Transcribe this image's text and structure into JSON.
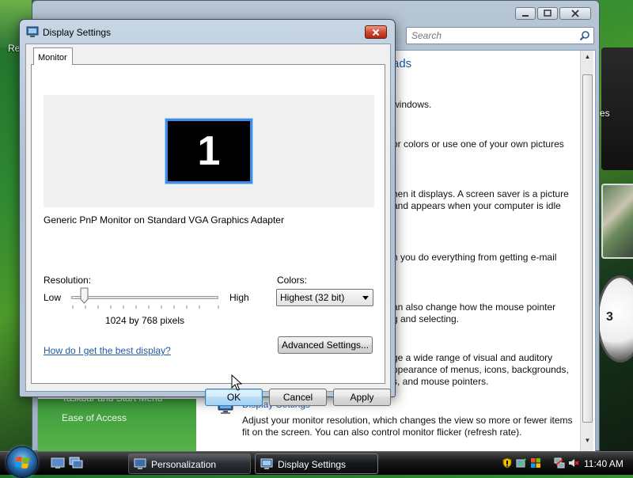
{
  "desktop": {
    "label_left": "Re",
    "label_right": "es",
    "clock_numeral": "3"
  },
  "personalization_window": {
    "search_placeholder": "Search",
    "heading_fragment": "ads",
    "text_lines": [
      "windows.",
      "or colors or use one of your own pictures",
      "hen it displays. A screen saver is a picture",
      "and appears when your computer is idle",
      "n you do everything from getting e-mail",
      "an also change how the mouse pointer",
      "g and selecting.",
      "ge a wide range of visual and auditory",
      "ppearance of menus, icons, backgrounds,",
      "s, and mouse pointers."
    ],
    "sidebar": {
      "item1": "Taskbar and Start Menu",
      "item2": "Ease of Access"
    },
    "display_settings_link": "Display Settings",
    "display_settings_desc": "Adjust your monitor resolution, which changes the view so more or fewer items fit on the screen. You can also control monitor flicker (refresh rate)."
  },
  "dialog": {
    "title": "Display Settings",
    "tab": "Monitor",
    "monitor_number": "1",
    "adapter": "Generic PnP Monitor on Standard VGA Graphics Adapter",
    "resolution_label": "Resolution:",
    "low_label": "Low",
    "high_label": "High",
    "resolution_value": "1024 by 768 pixels",
    "colors_label": "Colors:",
    "colors_value": "Highest (32 bit)",
    "help_link": "How do I get the best display?",
    "advanced_button": "Advanced Settings...",
    "ok_button": "OK",
    "cancel_button": "Cancel",
    "apply_button": "Apply"
  },
  "taskbar": {
    "buttons": [
      {
        "label": "Personalization",
        "icon": "monitor-icon"
      },
      {
        "label": "Display Settings",
        "icon": "display-settings-icon"
      }
    ],
    "time": "11:40 AM"
  }
}
